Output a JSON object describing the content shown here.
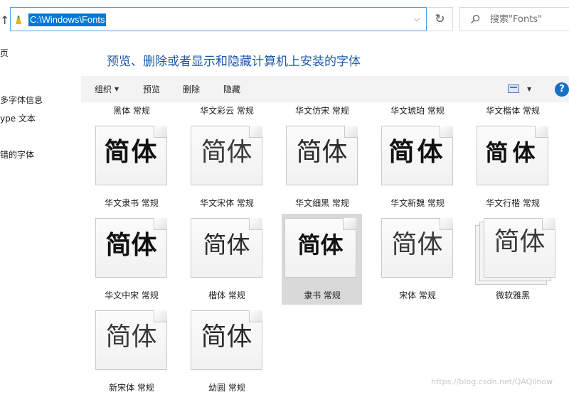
{
  "address_bar": {
    "path": "C:\\Windows\\Fonts"
  },
  "search": {
    "placeholder": "搜索\"Fonts\""
  },
  "nav": {
    "items": [
      "页",
      "多字体信息",
      "ype 文本",
      "错的字体"
    ]
  },
  "title": "预览、删除或者显示和隐藏计算机上安装的字体",
  "toolbar": {
    "organize": "组织",
    "preview": "预览",
    "delete": "删除",
    "hide": "隐藏",
    "help": "?"
  },
  "fonts_row0": [
    "黑体 常规",
    "华文彩云 常规",
    "华文仿宋 常规",
    "华文琥珀 常规",
    "华文楷体 常规"
  ],
  "fonts": [
    {
      "sample": "简体",
      "label": "华文隶书 常规"
    },
    {
      "sample": "简体",
      "label": "华文宋体 常规"
    },
    {
      "sample": "简体",
      "label": "华文细黑 常规"
    },
    {
      "sample": "简体",
      "label": "华文新魏 常规"
    },
    {
      "sample": "简体",
      "label": "华文行楷 常规"
    },
    {
      "sample": "简体",
      "label": "华文中宋 常规"
    },
    {
      "sample": "简体",
      "label": "楷体 常规"
    },
    {
      "sample": "简体",
      "label": "隶书 常规",
      "selected": true
    },
    {
      "sample": "简体",
      "label": "宋体 常规"
    },
    {
      "sample": "简体",
      "label": "微软雅黑",
      "family": true
    },
    {
      "sample": "简体",
      "label": "新宋体 常规"
    },
    {
      "sample": "简体",
      "label": "幼圆 常规"
    }
  ],
  "watermark": "https://blog.csdn.net/QAQllnow",
  "colors": {
    "accent": "#0078d7",
    "title": "#1e5aa8",
    "selection": "#d9d9d9",
    "help": "#1570c8"
  }
}
